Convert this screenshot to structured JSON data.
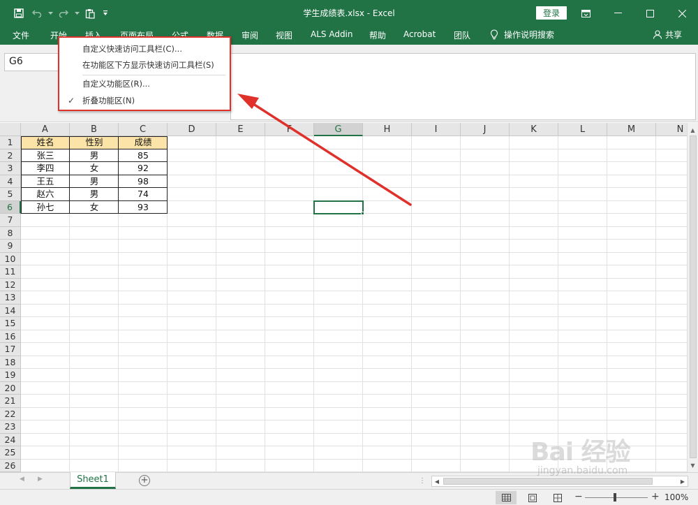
{
  "window": {
    "title": "学生成绩表.xlsx  -  Excel",
    "signin_label": "登录"
  },
  "ribbon": {
    "tabs": [
      "文件",
      "开始",
      "插入",
      "页面布局",
      "公式",
      "数据",
      "审阅",
      "视图",
      "ALS Addin",
      "帮助",
      "Acrobat",
      "团队"
    ],
    "tell_me": "操作说明搜索",
    "share": "共享"
  },
  "formula_bar": {
    "name_box": "G6",
    "content": ""
  },
  "context_menu": {
    "items": [
      {
        "label": "自定义快速访问工具栏(C)...",
        "checked": false
      },
      {
        "label": "在功能区下方显示快速访问工具栏(S)",
        "checked": false
      },
      {
        "label": "自定义功能区(R)...",
        "checked": false
      },
      {
        "label": "折叠功能区(N)",
        "checked": true
      }
    ],
    "check_glyph": "✓"
  },
  "sheet": {
    "columns": [
      "A",
      "B",
      "C",
      "D",
      "E",
      "F",
      "G",
      "H",
      "I",
      "J",
      "K",
      "L",
      "M",
      "N"
    ],
    "rows": [
      "1",
      "2",
      "3",
      "4",
      "5",
      "6",
      "7",
      "8",
      "9",
      "10",
      "11",
      "12",
      "13",
      "14",
      "15",
      "16",
      "17",
      "18",
      "19",
      "20",
      "21",
      "22",
      "23",
      "24",
      "25",
      "26"
    ],
    "selected_column": "G",
    "selected_row": "6",
    "table": {
      "headers": [
        "姓名",
        "性别",
        "成绩"
      ],
      "rows": [
        [
          "张三",
          "男",
          "85"
        ],
        [
          "李四",
          "女",
          "92"
        ],
        [
          "王五",
          "男",
          "98"
        ],
        [
          "赵六",
          "男",
          "74"
        ],
        [
          "孙七",
          "女",
          "93"
        ]
      ],
      "header_fill": "#fce4a8"
    }
  },
  "sheet_tabs": {
    "active": "Sheet1",
    "add_label": "+"
  },
  "status_bar": {
    "zoom": "100%",
    "zoom_minus": "−",
    "zoom_plus": "+"
  },
  "watermark": {
    "main": "Bai 经验",
    "sub": "jingyan.baidu.com"
  },
  "colors": {
    "brand": "#217346",
    "annotation": "#e0302a"
  }
}
